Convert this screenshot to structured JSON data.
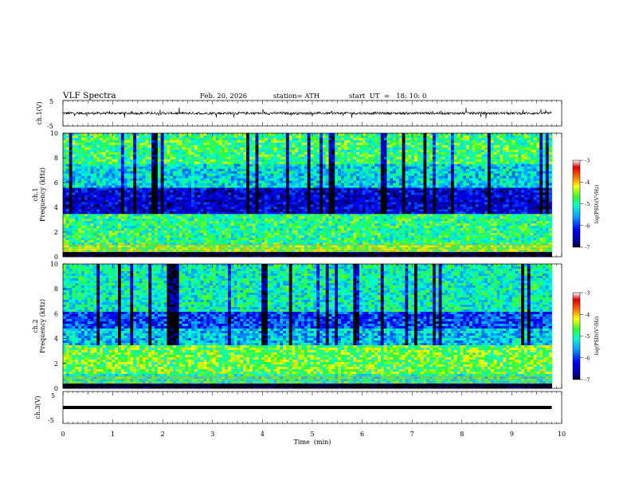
{
  "header": {
    "title": "VLF Spectra",
    "date": "Feb. 20, 2026",
    "station": "station= ATH",
    "start_ut": "start  UT  =   18: 10: 0"
  },
  "chart_data": [
    {
      "type": "line",
      "panel": "ch1-waveform",
      "ylabel": "ch.1(V)",
      "ylim": [
        -5,
        5
      ],
      "yticks": [
        5,
        -5
      ],
      "description_values": "continuous noisy waveform near 0 V with spikes",
      "baseline": 0,
      "noise_amplitude": 0.5,
      "spike_amplitude": 2
    },
    {
      "type": "heatmap",
      "panel": "ch1-spectrogram",
      "ylabel": "ch.1\nFrequency (kHz)",
      "ylabel_lines": [
        "ch.1",
        "Frequency (kHz)"
      ],
      "ylim": [
        0,
        10
      ],
      "yticks": [
        0,
        2,
        4,
        6,
        8,
        10
      ],
      "value_range": [
        -7,
        -3
      ],
      "bands": [
        {
          "from": 0,
          "to": 0.4,
          "level": -6.8
        },
        {
          "from": 0.4,
          "to": 1.0,
          "level": -4.5
        },
        {
          "from": 1.0,
          "to": 3.5,
          "level": -4.9
        },
        {
          "from": 3.5,
          "to": 5.5,
          "level": -6.4
        },
        {
          "from": 5.5,
          "to": 7.5,
          "level": -5.3
        },
        {
          "from": 7.5,
          "to": 10,
          "level": -4.8
        }
      ]
    },
    {
      "type": "heatmap",
      "panel": "ch2-spectrogram",
      "ylabel": "ch.2\nFrequency (kHz)",
      "ylabel_lines": [
        "ch.2",
        "Frequency (kHz)"
      ],
      "ylim": [
        0,
        10
      ],
      "yticks": [
        0,
        2,
        4,
        6,
        8,
        10
      ],
      "value_range": [
        -7,
        -3
      ],
      "bands": [
        {
          "from": 0,
          "to": 0.4,
          "level": -6.8
        },
        {
          "from": 0.4,
          "to": 1.2,
          "level": -5.0
        },
        {
          "from": 1.2,
          "to": 3.5,
          "level": -4.6
        },
        {
          "from": 3.5,
          "to": 4.8,
          "level": -5.4
        },
        {
          "from": 4.8,
          "to": 6.2,
          "level": -6.0
        },
        {
          "from": 6.2,
          "to": 10,
          "level": -5.1
        }
      ]
    },
    {
      "type": "line",
      "panel": "ch3-waveform",
      "ylabel": "ch.3(V)",
      "ylim": [
        -5,
        5
      ],
      "yticks": [
        5,
        -5
      ],
      "baseline": -1.8
    }
  ],
  "colorbars": [
    {
      "label": "log(PSD)(V²/Hz)",
      "ticks": [
        "-3",
        "-4",
        "-5",
        "-6",
        "-7"
      ]
    },
    {
      "label": "log(PSD)(V²/Hz)",
      "ticks": [
        "-3",
        "-4",
        "-5",
        "-6",
        "-7"
      ]
    }
  ],
  "x_axis": {
    "label": "Time  (min)",
    "xlim": [
      0,
      10
    ],
    "ticks": [
      "0",
      "1",
      "2",
      "3",
      "4",
      "5",
      "6",
      "7",
      "8",
      "9",
      "10"
    ],
    "data_end": 9.8
  }
}
